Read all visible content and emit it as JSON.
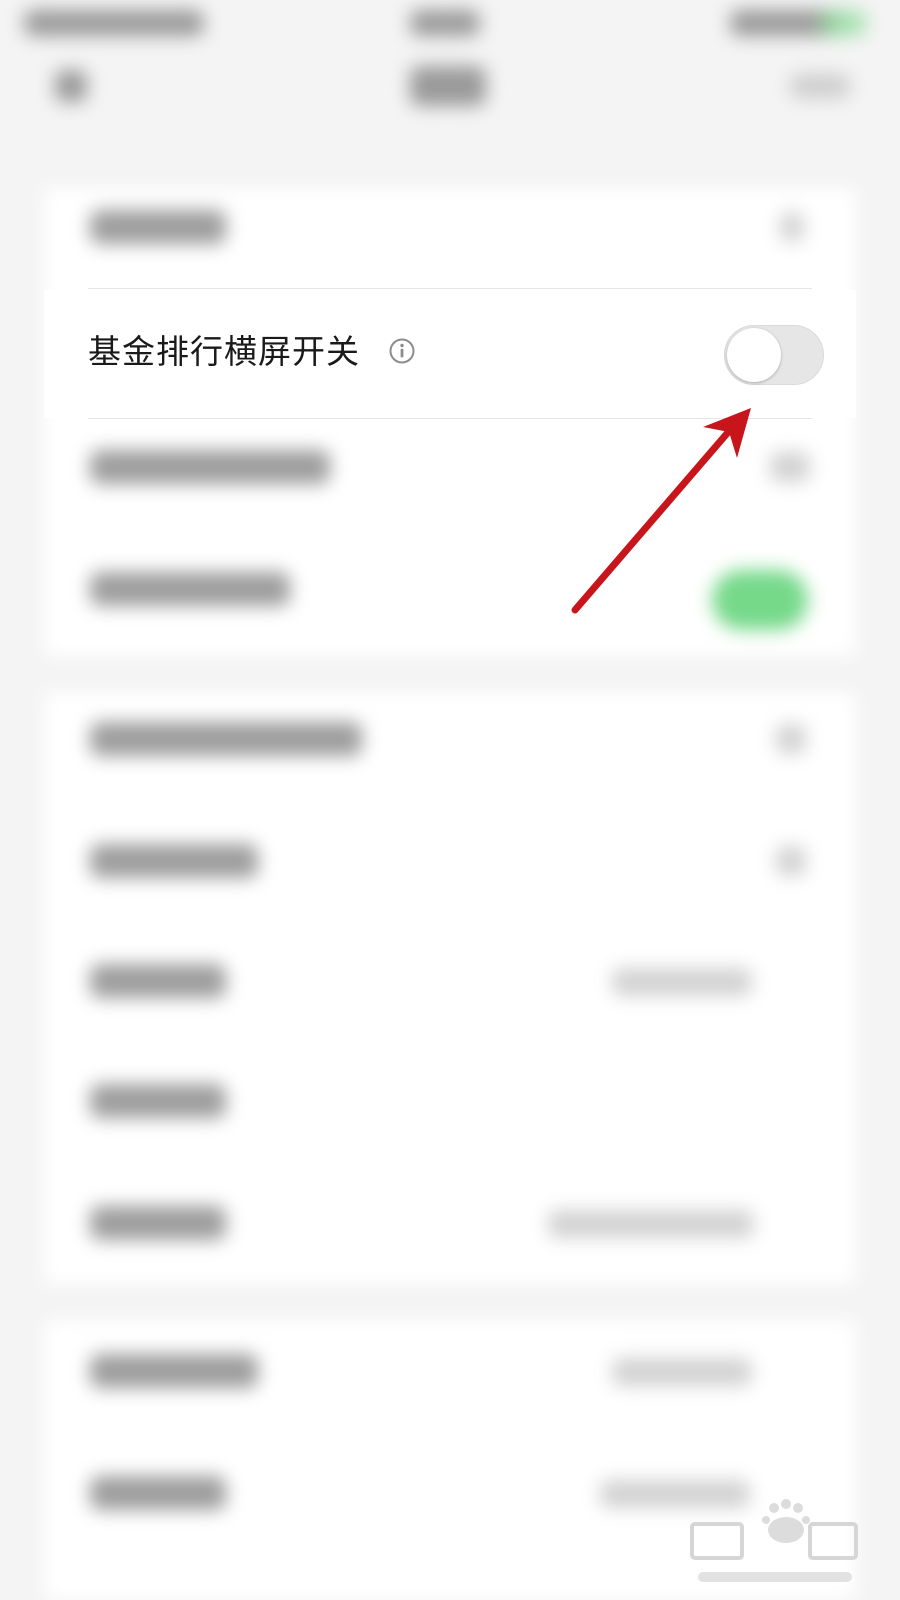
{
  "settings": {
    "landscape_toggle_row": {
      "label": "基金排行横屏开关",
      "toggle_on": false
    }
  },
  "colors": {
    "toggle_off_track": "#e6e6e6",
    "toggle_on_track": "#76d98a",
    "annotation_arrow": "#c8151b"
  },
  "icons": {
    "info": "info-circle-icon"
  }
}
